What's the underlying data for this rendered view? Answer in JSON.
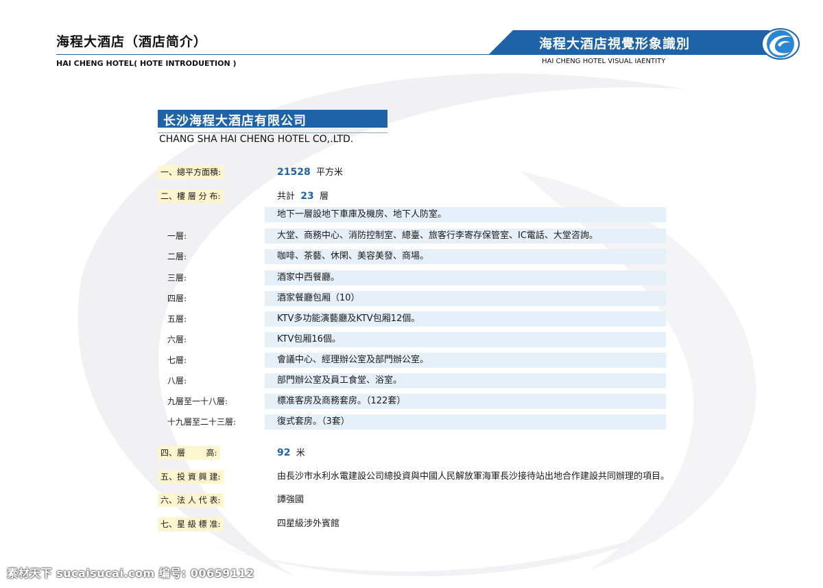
{
  "header": {
    "title_cn": "海程大酒店（酒店简介）",
    "title_en": "HAI CHENG HOTEL( HOTE INTRODUETION )",
    "band_text": "海程大酒店視覺形象識別",
    "right_en": "HAI CHENG HOTEL VISUAL IAENTITY",
    "accent": "#1e63a8"
  },
  "company": {
    "name_cn": "长沙海程大酒店有限公司",
    "name_en": "CHANG SHA HAI CHENG HOTEL CO,.LTD."
  },
  "area": {
    "label": "一、總平方面積:",
    "value": "21528",
    "unit": "平方米"
  },
  "floors": {
    "label": "二、樓 層 分 布:",
    "prefix": "共計",
    "value": "23",
    "unit": "層"
  },
  "floor_rows": [
    {
      "label": "",
      "text": "地下一層設地下車庫及機房、地下人防室。"
    },
    {
      "label": "一層:",
      "text": "大堂、商務中心、消防控制室、總臺、旅客行李寄存保管室、IC電話、大堂咨詢。"
    },
    {
      "label": "二層:",
      "text": "咖啡、茶藝、休閑、美容美發、商場。"
    },
    {
      "label": "三層:",
      "text": "酒家中西餐廳。"
    },
    {
      "label": "四層:",
      "text": "酒家餐廳包厢（10）"
    },
    {
      "label": "五層:",
      "text": "KTV多功能演藝廳及KTV包厢12個。"
    },
    {
      "label": "六層:",
      "text": "KTV包厢16個。"
    },
    {
      "label": "七層:",
      "text": "會議中心、經理辦公室及部門辦公室。"
    },
    {
      "label": "八層:",
      "text": "部門辦公室及員工食堂、浴室。"
    },
    {
      "label": "九層至一十八層:",
      "text": "標准客房及商務套房。（122套）"
    },
    {
      "label": "十九層至二十三層:",
      "text": "復式套房。（3套）"
    }
  ],
  "height": {
    "label": "四、層        高:",
    "value": "92",
    "unit": "米"
  },
  "investor": {
    "label": "五、投 資 興 建:",
    "text": "由長沙市水利水電建設公司總投資與中國人民解放軍海軍長沙接待站出地合作建設共同辦理的項目。"
  },
  "legal": {
    "label": "六、法 人 代 表:",
    "text": "譚強國"
  },
  "rating": {
    "label": "七、星 級 標 准:",
    "text": "四星級涉外賓館"
  },
  "watermark": "素材天下 sucaisucai.com  编号: 00659112"
}
